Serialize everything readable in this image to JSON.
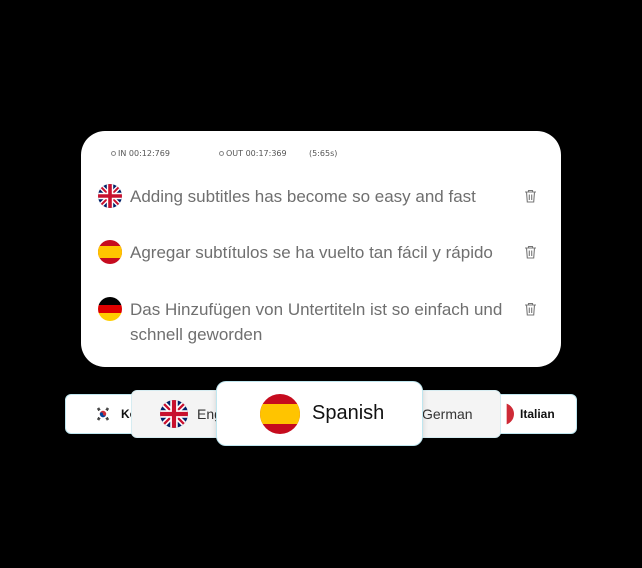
{
  "timing": {
    "in": "IN 00:12:769",
    "out": "OUT 00:17:369",
    "duration": "(5:65s)"
  },
  "subtitles": [
    {
      "lang": "English",
      "flag": "uk-flag-icon",
      "text": "Adding subtitles has become so easy and fast"
    },
    {
      "lang": "Spanish",
      "flag": "spain-flag-icon",
      "text": "Agregar subtítulos se ha vuelto tan fácil y rápido"
    },
    {
      "lang": "German",
      "flag": "germany-flag-icon",
      "text": "Das Hinzufügen von Untertiteln ist so einfach und schnell geworden"
    }
  ],
  "languages": {
    "korean": "Ko",
    "english": "Eng",
    "spanish": "Spanish",
    "german": "German",
    "italian": "Italian"
  },
  "icons": {
    "delete": "trash-icon",
    "time": "clock-icon"
  },
  "colors": {
    "card": "#ffffff",
    "text": "#6f6f6f",
    "chip_border": "#bfe6ef",
    "spain_red": "#c60b1e",
    "spain_yellow": "#ffc400"
  }
}
